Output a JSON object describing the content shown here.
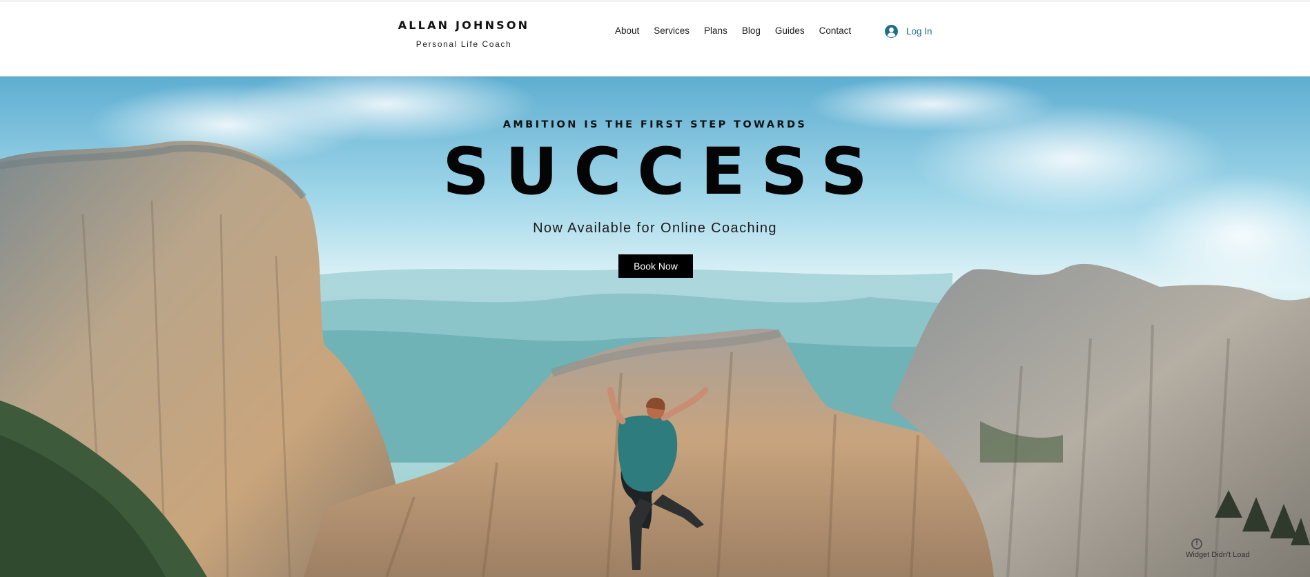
{
  "header": {
    "brand_name": "ALLAN JOHNSON",
    "brand_tagline": "Personal Life Coach",
    "nav": [
      "About",
      "Services",
      "Plans",
      "Blog",
      "Guides",
      "Contact"
    ],
    "login_label": "Log In",
    "login_icon": "user-avatar-icon"
  },
  "hero": {
    "eyebrow": "AMBITION IS THE FIRST STEP TOWARDS",
    "title": "SUCCESS",
    "subtitle": "Now Available for Online Coaching",
    "cta_label": "Book Now"
  },
  "widget": {
    "icon": "alert-icon",
    "icon_glyph": "!",
    "message": "Widget Didn't Load"
  },
  "colors": {
    "accent": "#1f6f87",
    "button_bg": "#000000",
    "button_text": "#ffffff",
    "title": "#050505"
  }
}
